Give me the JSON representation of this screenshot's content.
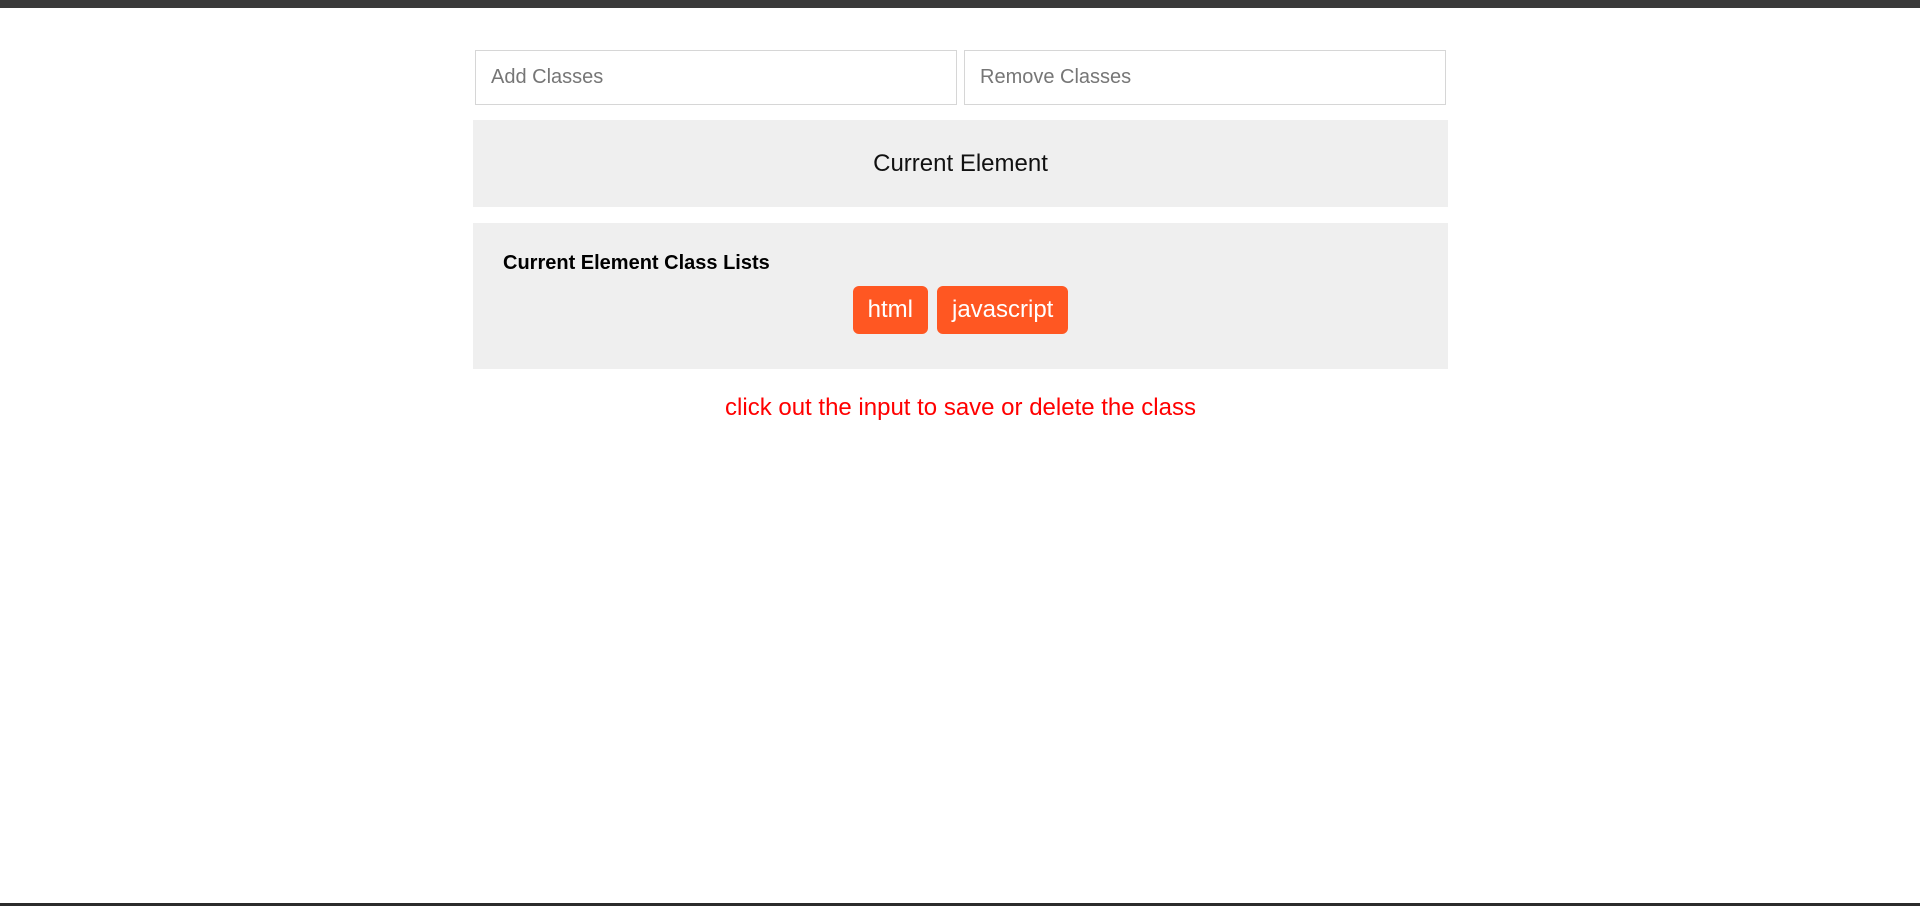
{
  "inputs": {
    "add_placeholder": "Add Classes",
    "add_value": "",
    "remove_placeholder": "Remove Classes",
    "remove_value": ""
  },
  "current_element": {
    "label": "Current Element"
  },
  "class_lists": {
    "title": "Current Element Class Lists",
    "classes": [
      "html",
      "javascript"
    ]
  },
  "hint": {
    "text": "click out the input to save or delete the class"
  },
  "colors": {
    "chip_bg": "#ff5722",
    "hint": "#ff0000",
    "panel_bg": "#efefef",
    "top_bar": "#3a3a3a"
  }
}
